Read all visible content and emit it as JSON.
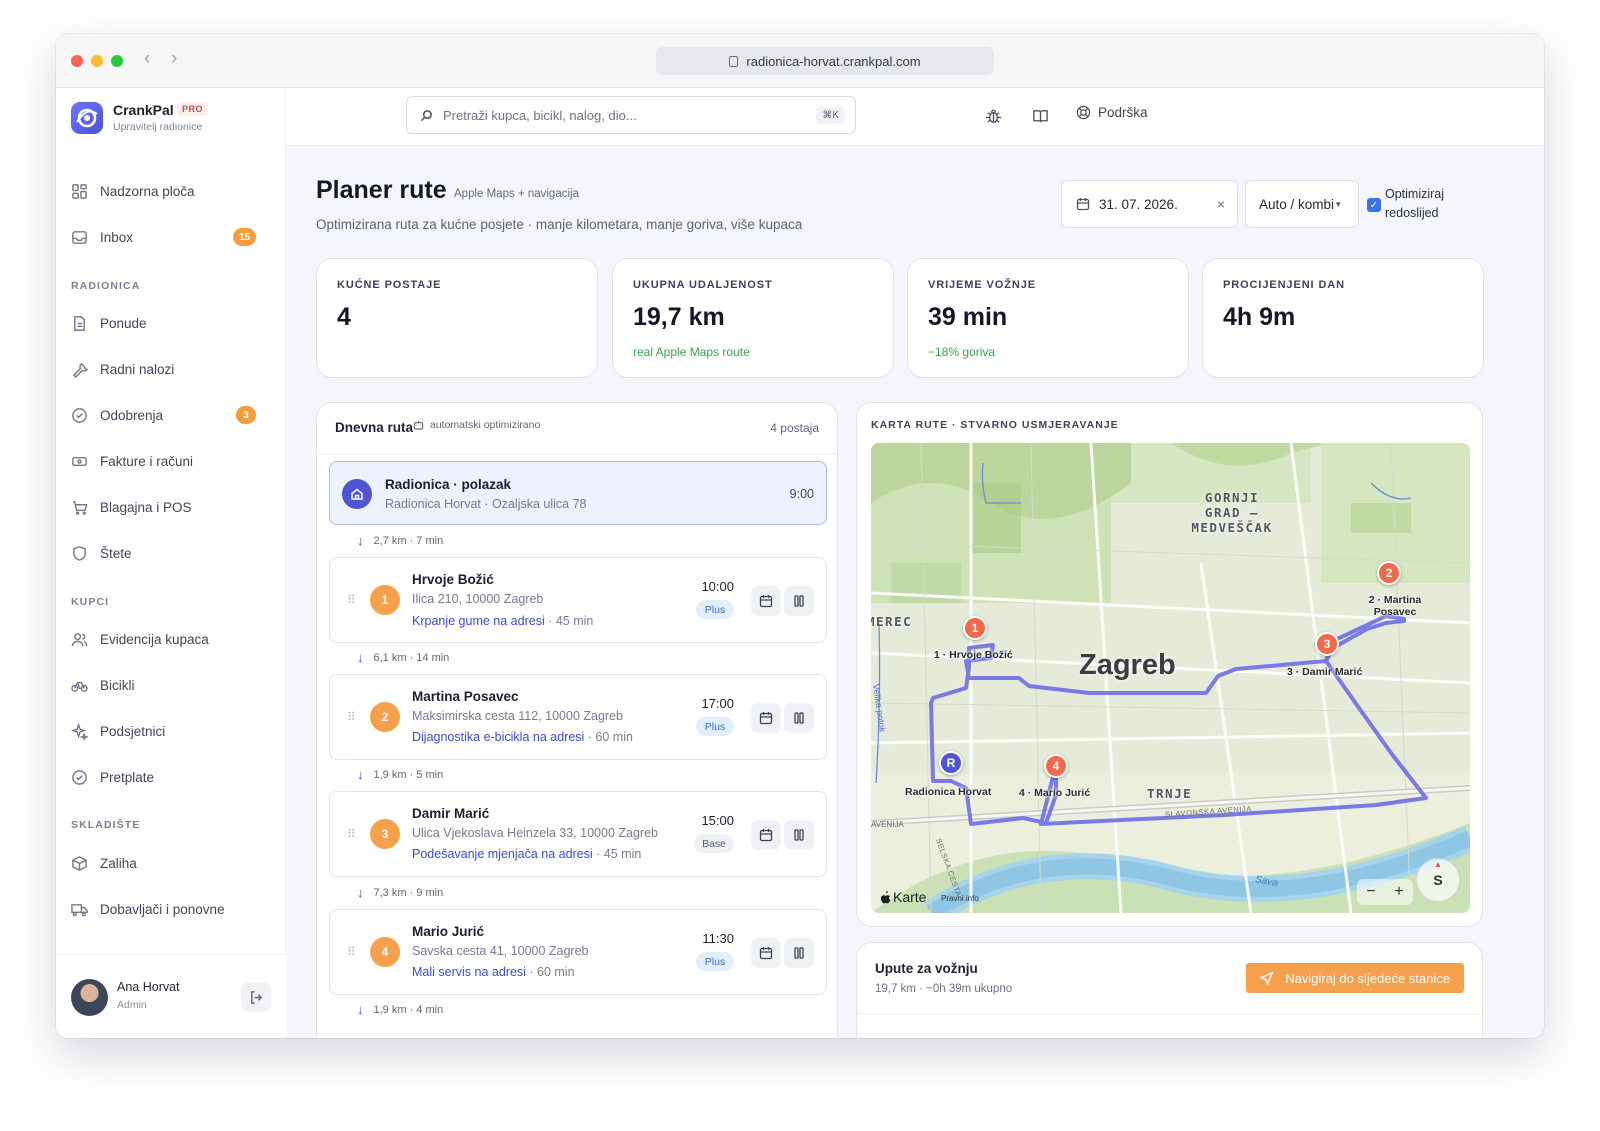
{
  "browser": {
    "url": "radionica-horvat.crankpal.com"
  },
  "brand": {
    "name": "CrankPal",
    "badge": "PRO",
    "subtitle": "Upravitelj radionice"
  },
  "search": {
    "placeholder": "Pretraži kupca, bicikl, nalog, dio...",
    "shortcut": "⌘K"
  },
  "topbar": {
    "support_label": "Podrška",
    "icons": [
      "bug-icon",
      "book-icon",
      "lifebuoy-icon"
    ]
  },
  "sidebar": {
    "top_items": [
      {
        "label": "Nadzorna ploča",
        "icon": "dashboard-icon"
      },
      {
        "label": "Inbox",
        "icon": "inbox-icon",
        "badge": "15"
      }
    ],
    "sections": [
      {
        "title": "RADIONICA",
        "items": [
          {
            "label": "Ponude",
            "icon": "document-icon"
          },
          {
            "label": "Radni nalozi",
            "icon": "wrench-icon"
          },
          {
            "label": "Odobrenja",
            "icon": "check-circle-icon",
            "badge": "3"
          },
          {
            "label": "Fakture i računi",
            "icon": "banknote-icon"
          },
          {
            "label": "Blagajna i POS",
            "icon": "cart-icon"
          },
          {
            "label": "Štete",
            "icon": "shield-icon"
          }
        ]
      },
      {
        "title": "KUPCI",
        "items": [
          {
            "label": "Evidencija kupaca",
            "icon": "users-icon"
          },
          {
            "label": "Bicikli",
            "icon": "bike-icon"
          },
          {
            "label": "Podsjetnici",
            "icon": "sparkle-icon"
          },
          {
            "label": "Pretplate",
            "icon": "check-circle-icon"
          }
        ]
      },
      {
        "title": "SKLADIŠTE",
        "items": [
          {
            "label": "Zaliha",
            "icon": "box-icon"
          },
          {
            "label": "Dobavljači i ponovne",
            "icon": "truck-icon"
          }
        ]
      }
    ]
  },
  "user": {
    "name": "Ana Horvat",
    "role": "Admin"
  },
  "page": {
    "title": "Planer rute",
    "title_tag": "Apple Maps + navigacija",
    "subtitle": "Optimizirana ruta za kućne posjete · manje kilometara, manje goriva, više kupaca",
    "date": "31. 07. 2026.",
    "vehicle": "Auto / kombi",
    "optimize_label": "Optimiziraj redoslijed",
    "optimize_checked": true
  },
  "stats": [
    {
      "label": "KUĆNE POSTAJE",
      "value": "4",
      "note": ""
    },
    {
      "label": "UKUPNA UDALJENOST",
      "value": "19,7 km",
      "note": "real Apple Maps route"
    },
    {
      "label": "VRIJEME VOŽNJE",
      "value": "39 min",
      "note": "−18% goriva"
    },
    {
      "label": "PROCIJENJENI DAN",
      "value": "4h 9m",
      "note": ""
    }
  ],
  "route": {
    "title": "Dnevna ruta",
    "tag": "automatski optimizirano",
    "count": "4 postaja",
    "start": {
      "name": "Radionica · polazak",
      "address": "Radionica Horvat · Ozaljska ulica 78",
      "time": "9:00"
    },
    "legs": [
      "2,7 km · 7 min",
      "6,1 km · 14 min",
      "1,9 km · 5 min",
      "7,3 km · 9 min",
      "1,9 km · 4 min"
    ],
    "stops": [
      {
        "num": "1",
        "name": "Hrvoje Božić",
        "address": "Ilica 210, 10000 Zagreb",
        "service": "Krpanje gume na adresi",
        "duration": "· 45 min",
        "time": "10:00",
        "plan": "Plus"
      },
      {
        "num": "2",
        "name": "Martina Posavec",
        "address": "Maksimirska cesta 112, 10000 Zagreb",
        "service": "Dijagnostika e-bicikla na adresi",
        "duration": "· 60 min",
        "time": "17:00",
        "plan": "Plus"
      },
      {
        "num": "3",
        "name": "Damir Marić",
        "address": "Ulica Vjekoslava Heinzela 33, 10000 Zagreb",
        "service": "Podešavanje mjenjača na adresi",
        "duration": "· 45 min",
        "time": "15:00",
        "plan": "Base"
      },
      {
        "num": "4",
        "name": "Mario Jurić",
        "address": "Savska cesta 41, 10000 Zagreb",
        "service": "Mali servis na adresi",
        "duration": "· 60 min",
        "time": "11:30",
        "plan": "Plus"
      }
    ]
  },
  "map": {
    "title": "KARTA RUTE · STVARNO USMJERAVANJE",
    "city": "Zagreb",
    "districts": [
      "GORNJI GRAD – MEDVEŠČAK",
      "TRNJE",
      "MEREC"
    ],
    "road_labels": [
      "Velika potok",
      "Sava",
      "SLAVONSKA AVENIJA",
      "AVENIJA",
      "SELSKA CESTA"
    ],
    "attribution": "Karte",
    "legal": "Pravni info",
    "compass": "S",
    "zoom_out": "−",
    "zoom_in": "+",
    "markers": [
      {
        "id": "R",
        "label": "Radionica Horvat",
        "color": "#4f54d4"
      },
      {
        "id": "1",
        "label": "1 · Hrvoje Božić",
        "color": "#ee6a4a"
      },
      {
        "id": "2",
        "label": "2 · Martina Posavec",
        "color": "#ee6a4a"
      },
      {
        "id": "3",
        "label": "3 · Damir Marić",
        "color": "#ee6a4a"
      },
      {
        "id": "4",
        "label": "4 · Mario Jurić",
        "color": "#ee6a4a"
      }
    ],
    "route_color": "#6b6ee6"
  },
  "directions": {
    "title": "Upute za vožnju",
    "summary": "19,7 km · ~0h 39m ukupno",
    "nav_button": "Navigiraj do sljedeće stanice"
  },
  "colors": {
    "accent": "#4f54d4",
    "orange": "#f5a04a",
    "positive": "#37a74f"
  }
}
